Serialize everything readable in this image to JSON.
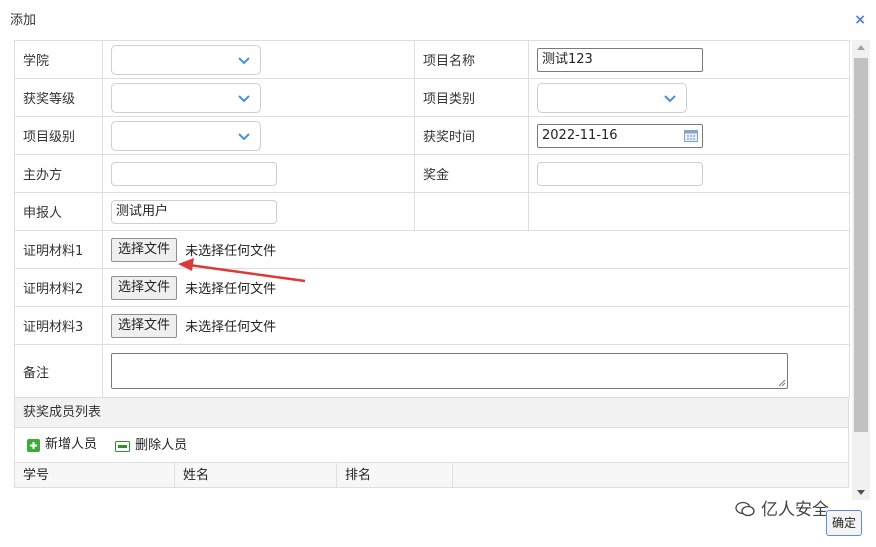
{
  "dialog": {
    "title": "添加",
    "close_symbol": "×"
  },
  "form": {
    "college_label": "学院",
    "project_name_label": "项目名称",
    "project_name_value": "测试123",
    "award_level_label": "获奖等级",
    "project_type_label": "项目类别",
    "project_level_label": "项目级别",
    "award_time_label": "获奖时间",
    "award_time_value": "2022-11-16",
    "organizer_label": "主办方",
    "prize_label": "奖金",
    "applicant_label": "申报人",
    "applicant_value": "测试用户",
    "proof1_label": "证明材料1",
    "proof2_label": "证明材料2",
    "proof3_label": "证明材料3",
    "choose_file_label": "选择文件",
    "no_file_text": "未选择任何文件",
    "remark_label": "备注"
  },
  "members": {
    "section_title": "获奖成员列表",
    "add_label": "新增人员",
    "delete_label": "删除人员",
    "columns": [
      "学号",
      "姓名",
      "排名"
    ]
  },
  "footer": {
    "ok_label": "确定",
    "watermark": "亿人安全"
  },
  "colors": {
    "accent": "#4a7fc1",
    "arrow": "#d93a3a",
    "add_icon": "#3cab3c"
  }
}
